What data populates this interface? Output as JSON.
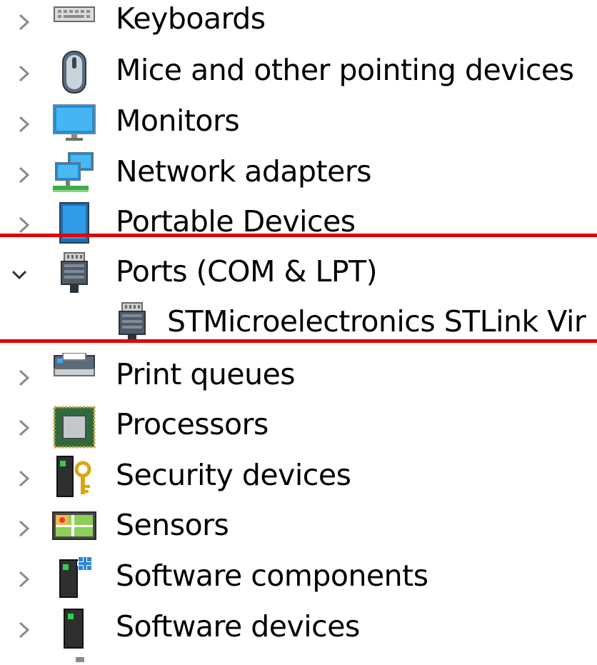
{
  "tree": {
    "items": [
      {
        "label": "Keyboards",
        "icon": "keyboard-icon",
        "state": "collapsed"
      },
      {
        "label": "Mice and other pointing devices",
        "icon": "mouse-icon",
        "state": "collapsed"
      },
      {
        "label": "Monitors",
        "icon": "monitor-icon",
        "state": "collapsed"
      },
      {
        "label": "Network adapters",
        "icon": "network-adapter-icon",
        "state": "collapsed"
      },
      {
        "label": "Portable Devices",
        "icon": "portable-device-icon",
        "state": "collapsed"
      },
      {
        "label": "Ports (COM & LPT)",
        "icon": "port-icon",
        "state": "expanded"
      },
      {
        "label": "STMicroelectronics STLink Vir",
        "icon": "port-icon",
        "state": "child"
      },
      {
        "label": "Print queues",
        "icon": "printer-icon",
        "state": "collapsed"
      },
      {
        "label": "Processors",
        "icon": "processor-icon",
        "state": "collapsed"
      },
      {
        "label": "Security devices",
        "icon": "security-device-icon",
        "state": "collapsed"
      },
      {
        "label": "Sensors",
        "icon": "sensor-icon",
        "state": "collapsed"
      },
      {
        "label": "Software components",
        "icon": "software-component-icon",
        "state": "collapsed"
      },
      {
        "label": "Software devices",
        "icon": "software-device-icon",
        "state": "collapsed"
      }
    ]
  },
  "colors": {
    "highlight_line": "#e00000",
    "chevron": "#8a8a8a",
    "text": "#000000"
  }
}
